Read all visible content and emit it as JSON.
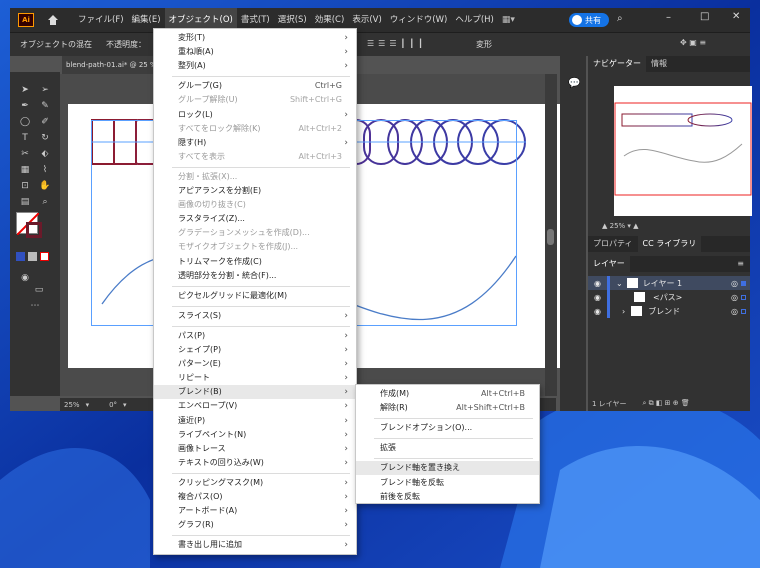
{
  "menubar": {
    "items": [
      "ファイル(F)",
      "編集(E)",
      "オブジェクト(O)",
      "書式(T)",
      "選択(S)",
      "効果(C)",
      "表示(V)",
      "ウィンドウ(W)",
      "ヘルプ(H)"
    ],
    "share": "共有",
    "app_icon": "Ai"
  },
  "optbar": {
    "object": "オブジェクトの混在",
    "opacity": "不透明度：",
    "transform": "変形"
  },
  "doc_tab": "blend-path-01.ai* @ 25 % (",
  "status": {
    "zoom": "25%",
    "angle": "0°"
  },
  "panel": {
    "nav_tab": "ナビゲーター",
    "info_tab": "情報",
    "zoom": "25%",
    "prop_tab": "プロパティ",
    "lib_tab": "CC ライブラリ",
    "layers_tab": "レイヤー",
    "layer1": "レイヤー 1",
    "path": "<パス>",
    "blend": "ブレンド",
    "footer": "1 レイヤー"
  },
  "menu": [
    {
      "label": "変形(T)",
      "arrow": true
    },
    {
      "label": "重ね順(A)",
      "arrow": true
    },
    {
      "label": "整列(A)",
      "arrow": true
    },
    {
      "sep": true
    },
    {
      "label": "グループ(G)",
      "sc": "Ctrl+G"
    },
    {
      "label": "グループ解除(U)",
      "sc": "Shift+Ctrl+G",
      "dis": true
    },
    {
      "label": "ロック(L)",
      "arrow": true
    },
    {
      "label": "すべてをロック解除(K)",
      "sc": "Alt+Ctrl+2",
      "dis": true
    },
    {
      "label": "隠す(H)",
      "arrow": true
    },
    {
      "label": "すべてを表示",
      "sc": "Alt+Ctrl+3",
      "dis": true
    },
    {
      "sep": true
    },
    {
      "label": "分割・拡張(X)...",
      "dis": true
    },
    {
      "label": "アピアランスを分割(E)"
    },
    {
      "label": "画像の切り抜き(C)",
      "dis": true
    },
    {
      "label": "ラスタライズ(Z)..."
    },
    {
      "label": "グラデーションメッシュを作成(D)...",
      "dis": true
    },
    {
      "label": "モザイクオブジェクトを作成(J)...",
      "dis": true
    },
    {
      "label": "トリムマークを作成(C)"
    },
    {
      "label": "透明部分を分割・統合(F)..."
    },
    {
      "sep": true
    },
    {
      "label": "ピクセルグリッドに最適化(M)"
    },
    {
      "sep": true
    },
    {
      "label": "スライス(S)",
      "arrow": true
    },
    {
      "sep": true
    },
    {
      "label": "パス(P)",
      "arrow": true
    },
    {
      "label": "シェイプ(P)",
      "arrow": true
    },
    {
      "label": "パターン(E)",
      "arrow": true
    },
    {
      "label": "リピート",
      "arrow": true
    },
    {
      "label": "ブレンド(B)",
      "arrow": true,
      "hov": true
    },
    {
      "label": "エンベロープ(V)",
      "arrow": true
    },
    {
      "label": "遠近(P)",
      "arrow": true
    },
    {
      "label": "ライブペイント(N)",
      "arrow": true
    },
    {
      "label": "画像トレース",
      "arrow": true
    },
    {
      "label": "テキストの回り込み(W)",
      "arrow": true
    },
    {
      "sep": true
    },
    {
      "label": "クリッピングマスク(M)",
      "arrow": true
    },
    {
      "label": "複合パス(O)",
      "arrow": true
    },
    {
      "label": "アートボード(A)",
      "arrow": true
    },
    {
      "label": "グラフ(R)",
      "arrow": true
    },
    {
      "sep": true
    },
    {
      "label": "書き出し用に追加",
      "arrow": true
    }
  ],
  "submenu": [
    {
      "label": "作成(M)",
      "sc": "Alt+Ctrl+B"
    },
    {
      "label": "解除(R)",
      "sc": "Alt+Shift+Ctrl+B"
    },
    {
      "sep": true
    },
    {
      "label": "ブレンドオプション(O)..."
    },
    {
      "sep": true
    },
    {
      "label": "拡張"
    },
    {
      "sep": true
    },
    {
      "label": "ブレンド軸を置き換え",
      "hov": true
    },
    {
      "label": "ブレンド軸を反転"
    },
    {
      "label": "前後を反転"
    }
  ],
  "colors": {
    "accent": "#1473e6",
    "menubar": "#2c2c2c",
    "workspace": "#535353",
    "shape_red": "#8b1a2e",
    "shape_blue": "#3b3fa8"
  }
}
